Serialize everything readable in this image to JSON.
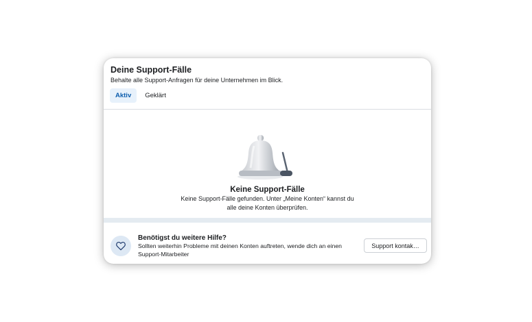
{
  "header": {
    "title": "Deine Support-Fälle",
    "subtitle": "Behalte alle Support-Anfragen für deine Unternehmen im Blick."
  },
  "tabs": [
    {
      "label": "Aktiv",
      "active": true
    },
    {
      "label": "Geklärt",
      "active": false
    }
  ],
  "empty_state": {
    "icon": "bell-icon",
    "title": "Keine Support-Fälle",
    "text": "Keine Support-Fälle gefunden. Unter „Meine Konten“ kannst du alle deine Konten überprüfen."
  },
  "help": {
    "icon": "heart-icon",
    "title": "Benötigst du weitere Hilfe?",
    "text": "Sollten weiterhin Probleme mit deinen Konten auftreten, wende dich an einen Support-Mitarbeiter",
    "button_label": "Support kontak…"
  },
  "colors": {
    "accent": "#0b5cad",
    "tab_active_bg": "#e7f1fb",
    "band": "#e4ebf1"
  }
}
